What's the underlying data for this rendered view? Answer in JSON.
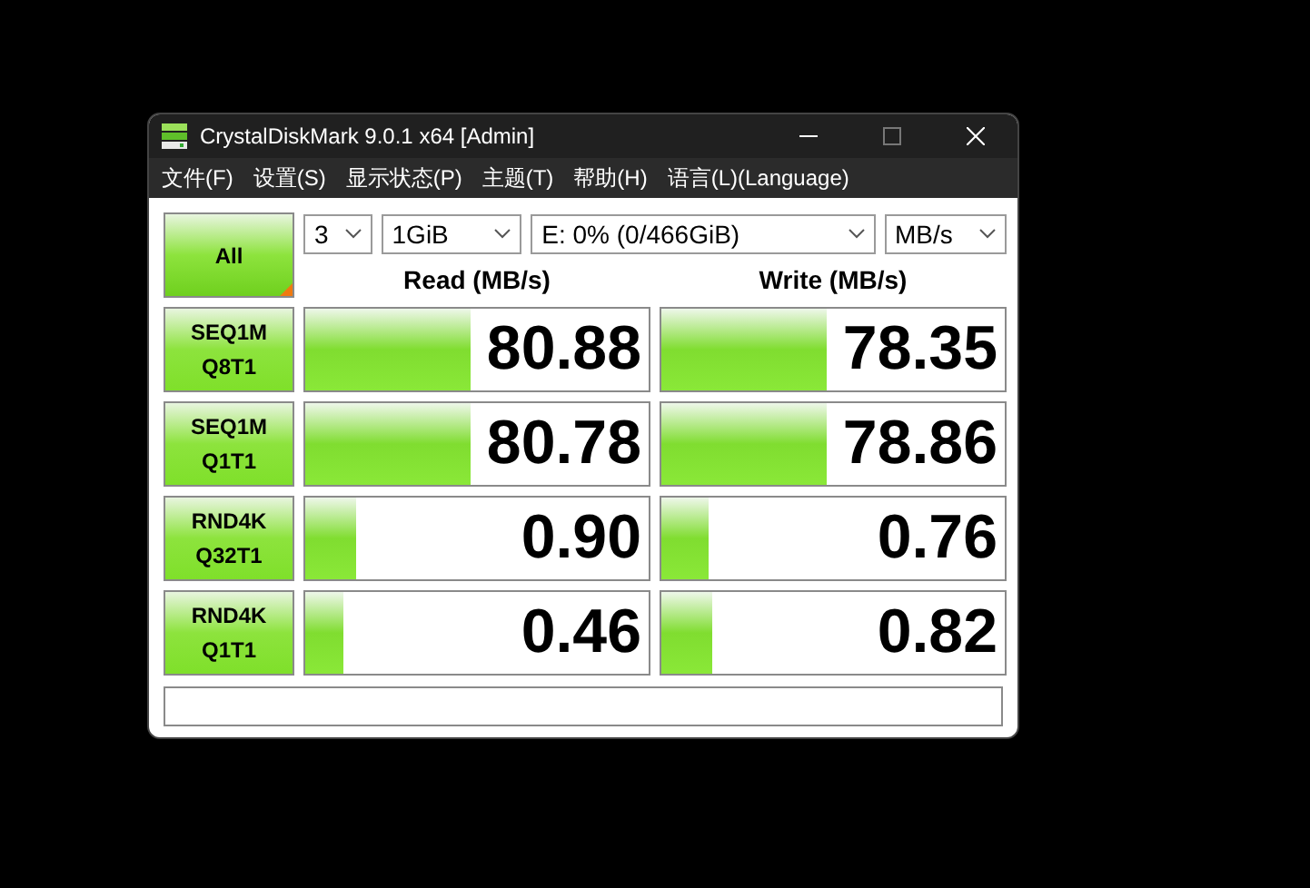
{
  "window": {
    "title": "CrystalDiskMark 9.0.1 x64 [Admin]"
  },
  "menu": [
    "文件(F)",
    "设置(S)",
    "显示状态(P)",
    "主题(T)",
    "帮助(H)",
    "语言(L)(Language)"
  ],
  "all_button": "All",
  "selectors": [
    {
      "value": "3"
    },
    {
      "value": "1GiB"
    },
    {
      "value": "E: 0% (0/466GiB)"
    },
    {
      "value": "MB/s"
    }
  ],
  "columns": [
    "Read (MB/s)",
    "Write (MB/s)"
  ],
  "rows": [
    {
      "test": [
        "SEQ1M",
        "Q8T1"
      ],
      "read": {
        "value": "80.88",
        "level": 0.48
      },
      "write": {
        "value": "78.35",
        "level": 0.48
      }
    },
    {
      "test": [
        "SEQ1M",
        "Q1T1"
      ],
      "read": {
        "value": "80.78",
        "level": 0.48
      },
      "write": {
        "value": "78.86",
        "level": 0.48
      }
    },
    {
      "test": [
        "RND4K",
        "Q32T1"
      ],
      "read": {
        "value": "0.90",
        "level": 0.15
      },
      "write": {
        "value": "0.76",
        "level": 0.14
      }
    },
    {
      "test": [
        "RND4K",
        "Q1T1"
      ],
      "read": {
        "value": "0.46",
        "level": 0.11
      },
      "write": {
        "value": "0.82",
        "level": 0.15
      }
    }
  ]
}
